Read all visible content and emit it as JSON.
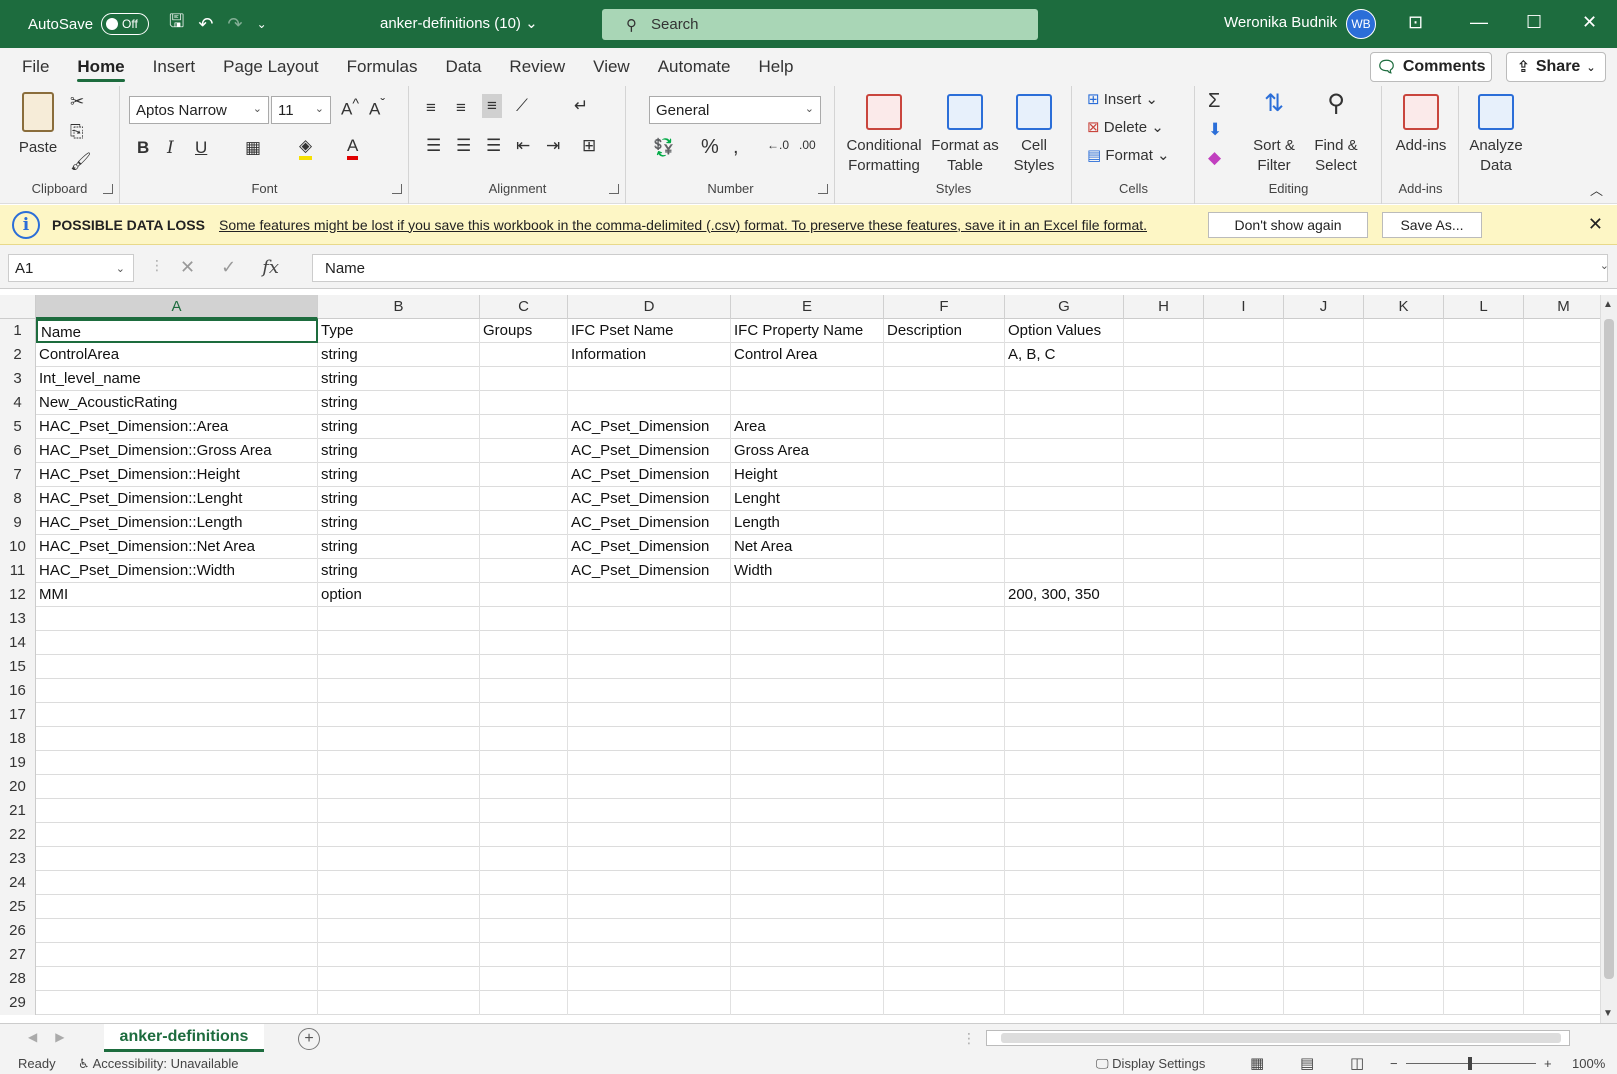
{
  "titlebar": {
    "autosave_label": "AutoSave",
    "autosave_state": "Off",
    "filename": "anker-definitions (10) ⌄",
    "search_placeholder": "Search",
    "user_name": "Weronika Budnik",
    "user_initials": "WB"
  },
  "menu": {
    "tabs": [
      "File",
      "Home",
      "Insert",
      "Page Layout",
      "Formulas",
      "Data",
      "Review",
      "View",
      "Automate",
      "Help"
    ],
    "active": "Home",
    "comments_label": "Comments",
    "share_label": "Share"
  },
  "ribbon": {
    "clipboard": {
      "label": "Clipboard",
      "paste": "Paste"
    },
    "font": {
      "label": "Font",
      "family": "Aptos Narrow",
      "size": "11"
    },
    "alignment": {
      "label": "Alignment"
    },
    "number": {
      "label": "Number",
      "format": "General"
    },
    "styles": {
      "label": "Styles",
      "conditional": "Conditional\nFormatting",
      "format_table": "Format as\nTable",
      "cell_styles": "Cell\nStyles"
    },
    "cells": {
      "label": "Cells",
      "insert": "Insert",
      "delete": "Delete",
      "format": "Format"
    },
    "editing": {
      "label": "Editing",
      "sort": "Sort &\nFilter",
      "find": "Find &\nSelect"
    },
    "addins": {
      "label": "Add-ins",
      "addins": "Add-ins"
    },
    "analyze": {
      "analyze": "Analyze\nData"
    }
  },
  "warning": {
    "title": "POSSIBLE DATA LOSS",
    "message": "Some features might be lost if you save this workbook in the comma-delimited (.csv) format. To preserve these features, save it in an Excel file format.",
    "dont_show": "Don't show again",
    "save_as": "Save As..."
  },
  "formula_bar": {
    "name_box": "A1",
    "content": "Name"
  },
  "columns": [
    "A",
    "B",
    "C",
    "D",
    "E",
    "F",
    "G",
    "H",
    "I",
    "J",
    "K",
    "L",
    "M"
  ],
  "rows": [
    [
      "Name",
      "Type",
      "Groups",
      "IFC Pset Name",
      "IFC Property Name",
      "Description",
      "Option Values"
    ],
    [
      "ControlArea",
      "string",
      "",
      "Information",
      "Control Area",
      "",
      "A, B, C"
    ],
    [
      "Int_level_name",
      "string",
      "",
      "",
      "",
      "",
      ""
    ],
    [
      "New_AcousticRating",
      "string",
      "",
      "",
      "",
      "",
      ""
    ],
    [
      "HAC_Pset_Dimension::Area",
      "string",
      "",
      "AC_Pset_Dimension",
      "Area",
      "",
      ""
    ],
    [
      "HAC_Pset_Dimension::Gross Area",
      "string",
      "",
      "AC_Pset_Dimension",
      "Gross Area",
      "",
      ""
    ],
    [
      "HAC_Pset_Dimension::Height",
      "string",
      "",
      "AC_Pset_Dimension",
      "Height",
      "",
      ""
    ],
    [
      "HAC_Pset_Dimension::Lenght",
      "string",
      "",
      "AC_Pset_Dimension",
      "Lenght",
      "",
      ""
    ],
    [
      "HAC_Pset_Dimension::Length",
      "string",
      "",
      "AC_Pset_Dimension",
      "Length",
      "",
      ""
    ],
    [
      "HAC_Pset_Dimension::Net Area",
      "string",
      "",
      "AC_Pset_Dimension",
      "Net Area",
      "",
      ""
    ],
    [
      "HAC_Pset_Dimension::Width",
      "string",
      "",
      "AC_Pset_Dimension",
      "Width",
      "",
      ""
    ],
    [
      "MMI",
      "option",
      "",
      "",
      "",
      "",
      "200, 300, 350"
    ]
  ],
  "row_count": 29,
  "sheet": {
    "active_tab": "anker-definitions"
  },
  "status": {
    "ready": "Ready",
    "accessibility": "Accessibility: Unavailable",
    "display_settings": "Display Settings",
    "zoom": "100%"
  },
  "colors": {
    "accent": "#1d6c3e",
    "warning_bg": "#fdf6c5"
  }
}
